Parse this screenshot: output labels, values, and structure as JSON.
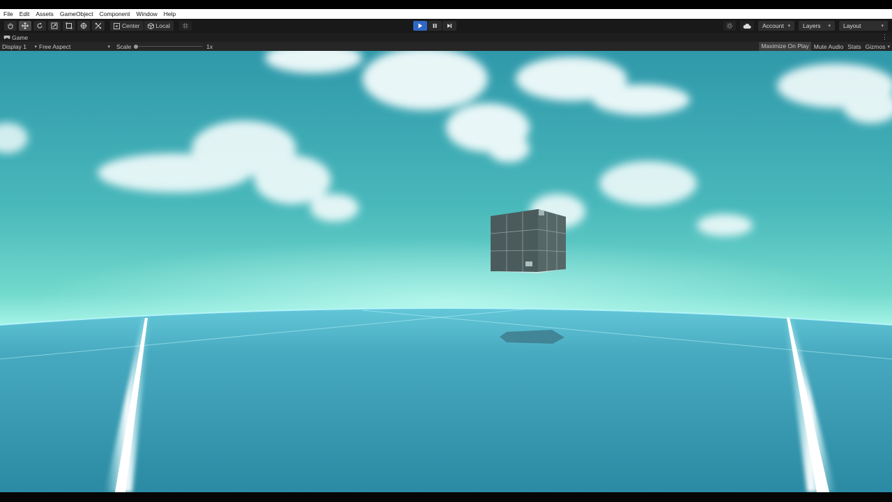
{
  "menu": [
    "File",
    "Edit",
    "Assets",
    "GameObject",
    "Component",
    "Window",
    "Help"
  ],
  "toolbar": {
    "tools": [
      "hand-tool-icon",
      "move-tool-icon",
      "rotate-tool-icon",
      "scale-tool-icon",
      "rect-tool-icon",
      "transform-tool-icon",
      "custom-tool-icon"
    ],
    "pivot_label": "Center",
    "space_label": "Local",
    "account_label": "Account",
    "layers_label": "Layers",
    "layout_label": "Layout",
    "play_active": true
  },
  "tab": {
    "title": "Game"
  },
  "gamebar": {
    "display": "Display 1",
    "aspect": "Free Aspect",
    "scale_label": "Scale",
    "scale_value": "1x",
    "maximize": "Maximize On Play",
    "mute": "Mute Audio",
    "stats": "Stats",
    "gizmos": "Gizmos"
  },
  "colors": {
    "play_accent": "#2f67c4",
    "sky_top": "#2f9aaa",
    "sky_horizon": "#9ef3e8",
    "ground": "#3a97b0",
    "cube": "#4a5a5a"
  }
}
